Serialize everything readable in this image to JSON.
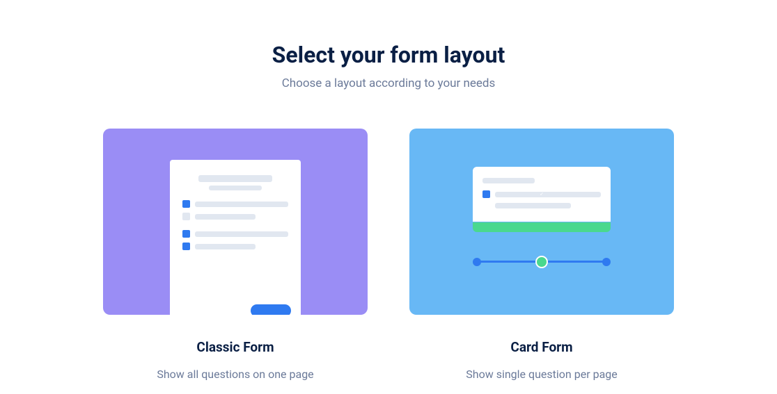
{
  "header": {
    "title": "Select your form layout",
    "subtitle": "Choose a layout according to your needs"
  },
  "options": [
    {
      "title": "Classic Form",
      "description": "Show all questions on one page"
    },
    {
      "title": "Card Form",
      "description": "Show single question per page"
    }
  ]
}
